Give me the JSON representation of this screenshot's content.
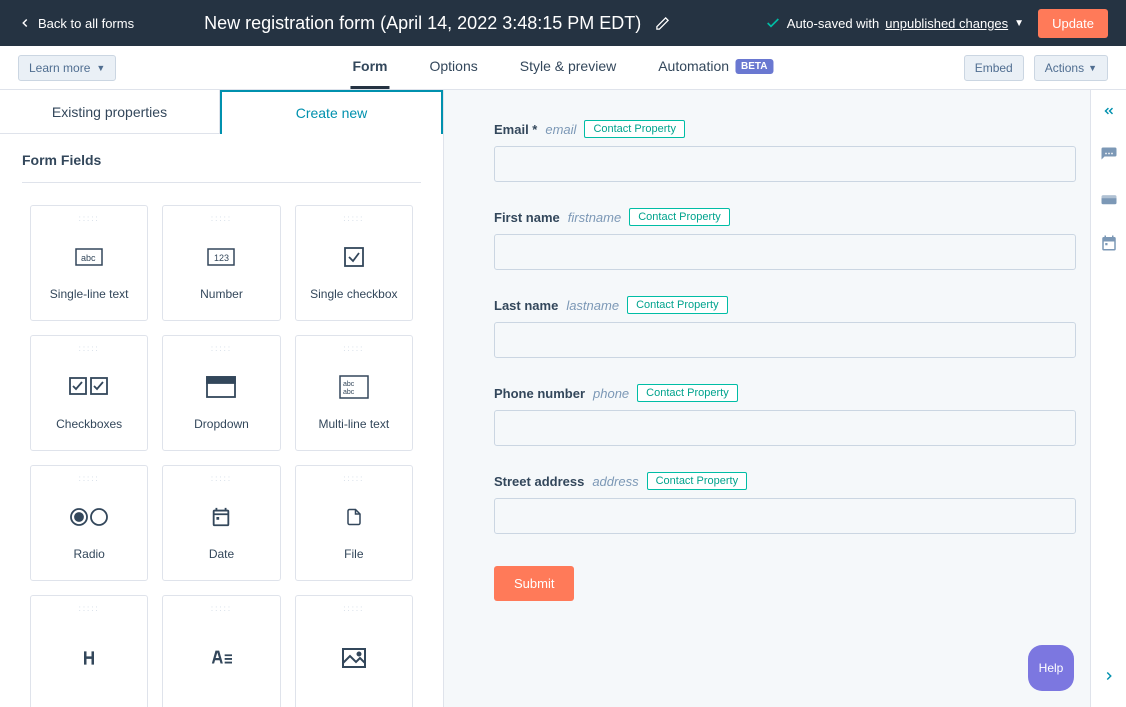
{
  "header": {
    "back_label": "Back to all forms",
    "title": "New registration form (April 14, 2022 3:48:15 PM EDT)",
    "autosave_prefix": "Auto-saved with ",
    "autosave_link": "unpublished changes",
    "update_label": "Update"
  },
  "subnav": {
    "learn_more": "Learn more",
    "tabs": [
      "Form",
      "Options",
      "Style & preview",
      "Automation"
    ],
    "beta": "BETA",
    "embed": "Embed",
    "actions": "Actions"
  },
  "panel": {
    "tabs": [
      "Existing properties",
      "Create new"
    ],
    "section_title": "Form Fields",
    "field_types": [
      "Single-line text",
      "Number",
      "Single checkbox",
      "Checkboxes",
      "Dropdown",
      "Multi-line text",
      "Radio",
      "Date",
      "File",
      "Header",
      "Rich text",
      "Image"
    ]
  },
  "form": {
    "fields": [
      {
        "label": "Email *",
        "name": "email",
        "tag": "Contact Property"
      },
      {
        "label": "First name",
        "name": "firstname",
        "tag": "Contact Property"
      },
      {
        "label": "Last name",
        "name": "lastname",
        "tag": "Contact Property"
      },
      {
        "label": "Phone number",
        "name": "phone",
        "tag": "Contact Property"
      },
      {
        "label": "Street address",
        "name": "address",
        "tag": "Contact Property"
      }
    ],
    "submit": "Submit"
  },
  "help": "Help"
}
